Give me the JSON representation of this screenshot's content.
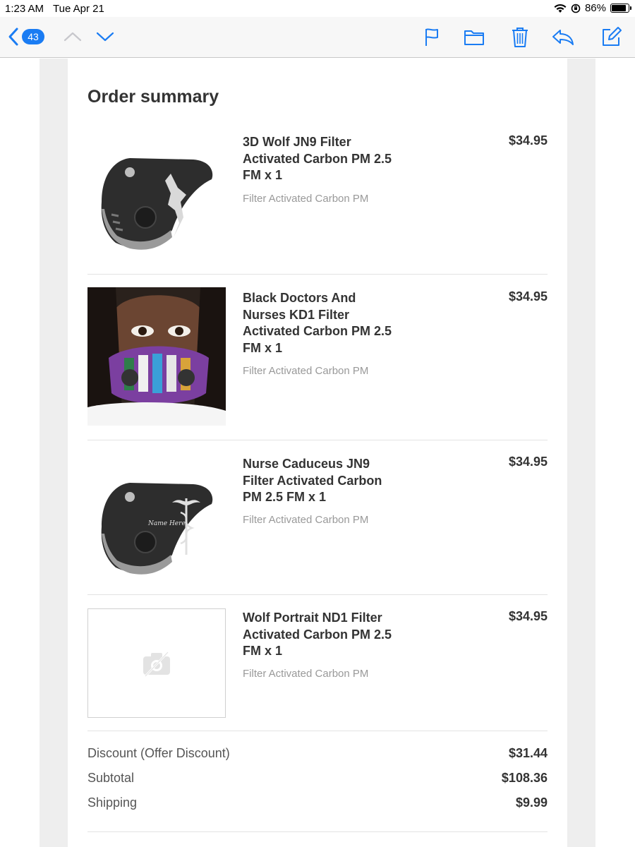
{
  "status": {
    "time": "1:23 AM",
    "date": "Tue Apr 21",
    "battery": "86%",
    "battery_level": 0.86
  },
  "toolbar": {
    "unread_count": "43"
  },
  "order": {
    "title": "Order summary",
    "items": [
      {
        "name": "3D Wolf JN9 Filter Activated Carbon PM 2.5 FM x 1",
        "variant": "Filter Activated Carbon PM",
        "price": "$34.95",
        "image": "black-wolf-mask"
      },
      {
        "name": "Black Doctors And Nurses KD1 Filter Activated Carbon PM 2.5 FM x 1",
        "variant": "Filter Activated Carbon PM",
        "price": "$34.95",
        "image": "woman-wearing-colorful-mask"
      },
      {
        "name": "Nurse Caduceus JN9 Filter Activated Carbon PM 2.5 FM x 1",
        "variant": "Filter Activated Carbon PM",
        "price": "$34.95",
        "image": "black-caduceus-mask",
        "image_text": "Name Here"
      },
      {
        "name": "Wolf Portrait ND1 Filter Activated Carbon PM 2.5 FM x 1",
        "variant": "Filter Activated Carbon PM",
        "price": "$34.95",
        "image": "image-unavailable-icon"
      }
    ],
    "totals": [
      {
        "label": "Discount (Offer Discount)",
        "value": "$31.44"
      },
      {
        "label": "Subtotal",
        "value": "$108.36"
      },
      {
        "label": "Shipping",
        "value": "$9.99"
      }
    ]
  },
  "colors": {
    "accent": "#1a7cf3",
    "text": "#333333",
    "muted": "#999999",
    "gutter": "#eeeeee"
  }
}
